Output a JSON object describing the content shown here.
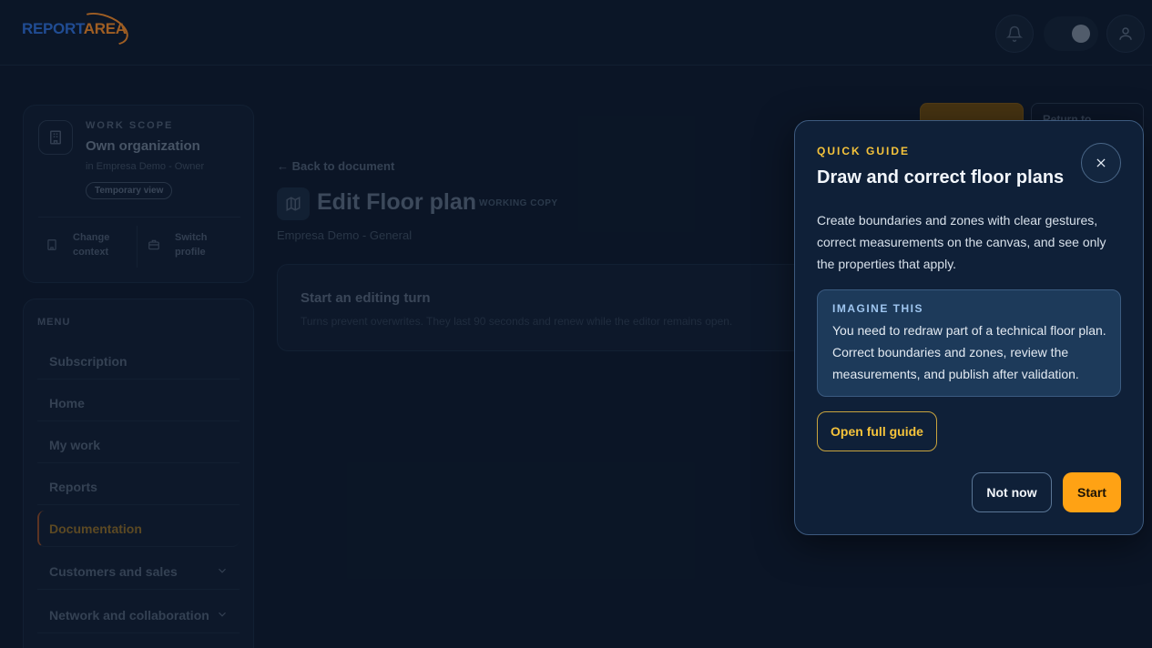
{
  "logo": {
    "part1": "REPORT",
    "part2": "AREA"
  },
  "topbar": {
    "notifications_icon": "bell-icon",
    "theme_icon": "moon-icon",
    "account_icon": "user-icon"
  },
  "scope": {
    "eyebrow": "WORK SCOPE",
    "title": "Own organization",
    "subtitle": "in Empresa Demo - Owner",
    "chip": "Temporary view",
    "change_context": "Change context",
    "switch_profile": "Switch profile"
  },
  "menu": {
    "label": "MENU",
    "items": [
      {
        "label": "Subscription"
      },
      {
        "label": "Home"
      },
      {
        "label": "My work"
      },
      {
        "label": "Reports"
      },
      {
        "label": "Documentation"
      },
      {
        "label": "Customers and sales"
      },
      {
        "label": "Network and collaboration"
      }
    ]
  },
  "main": {
    "secondary_button": "Return to General",
    "back_link": "← Back to document",
    "title": "Edit Floor plan",
    "badge": "WORKING COPY",
    "subtitle": "Empresa Demo - General",
    "turn_title": "Start an editing turn",
    "turn_text": "Turns prevent overwrites. They last 90 seconds and renew while the editor remains open."
  },
  "guide": {
    "eyebrow": "QUICK GUIDE",
    "title": "Draw and correct floor plans",
    "body": "Create boundaries and zones with clear gestures, correct measurements on the canvas, and see only the properties that apply.",
    "imagine_label": "IMAGINE THIS",
    "imagine_text": "You need to redraw part of a technical floor plan. Correct boundaries and zones, review the measurements, and publish after validation.",
    "open_full_guide": "Open full guide",
    "not_now": "Not now",
    "start": "Start"
  },
  "colors": {
    "accent": "#ffa214",
    "eyebrow": "#f5c33b",
    "background": "#0e1b2e"
  }
}
